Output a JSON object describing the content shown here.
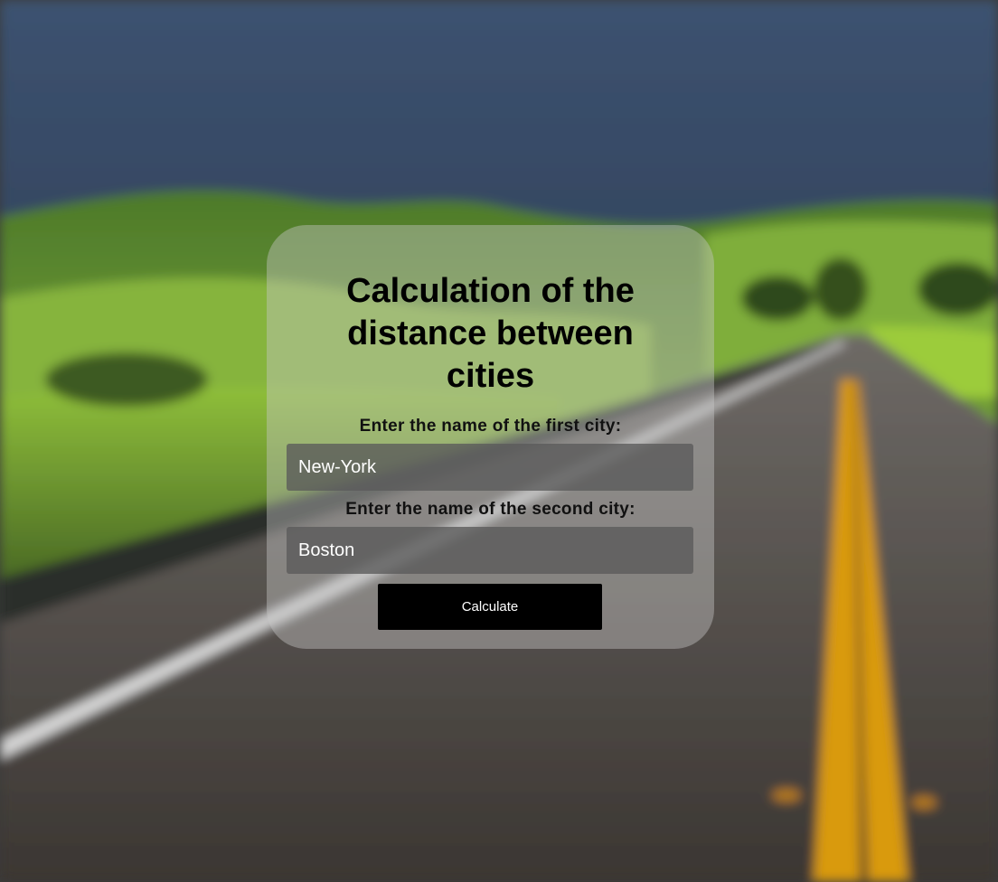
{
  "form": {
    "title_lines": [
      "Calculation of the",
      "distance between",
      "cities"
    ],
    "first_city_label": "Enter the name of the first city:",
    "first_city_value": "New-York",
    "second_city_label": "Enter the name of the second city:",
    "second_city_value": "Boston",
    "calculate_label": "Calculate"
  },
  "colors": {
    "button": "#000000",
    "input_background": "#5a5a5a",
    "card_background": "#c8c8c8"
  }
}
